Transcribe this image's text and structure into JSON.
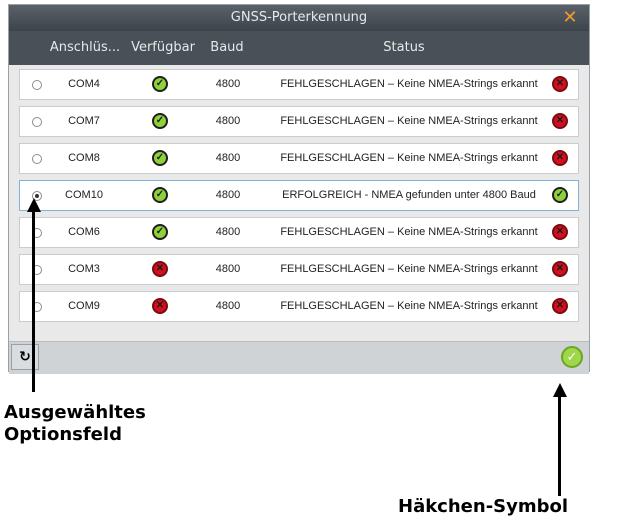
{
  "window": {
    "title": "GNSS-Porterkennung",
    "close_icon": "close-icon"
  },
  "columns": {
    "port": "Anschlüs...",
    "available": "Verfügbar",
    "baud": "Baud",
    "status": "Status"
  },
  "rows": [
    {
      "port": "COM4",
      "available": "ok",
      "baud": "4800",
      "status": "FEHLGESCHLAGEN – Keine NMEA-Strings erkannt",
      "result": "err",
      "selected": false
    },
    {
      "port": "COM7",
      "available": "ok",
      "baud": "4800",
      "status": "FEHLGESCHLAGEN – Keine NMEA-Strings erkannt",
      "result": "err",
      "selected": false
    },
    {
      "port": "COM8",
      "available": "ok",
      "baud": "4800",
      "status": "FEHLGESCHLAGEN – Keine NMEA-Strings erkannt",
      "result": "err",
      "selected": false
    },
    {
      "port": "COM10",
      "available": "ok",
      "baud": "4800",
      "status": "ERFOLGREICH - NMEA gefunden unter 4800 Baud",
      "result": "ok",
      "selected": true
    },
    {
      "port": "COM6",
      "available": "ok",
      "baud": "4800",
      "status": "FEHLGESCHLAGEN – Keine NMEA-Strings erkannt",
      "result": "err",
      "selected": false
    },
    {
      "port": "COM3",
      "available": "err",
      "baud": "4800",
      "status": "FEHLGESCHLAGEN – Keine NMEA-Strings erkannt",
      "result": "err",
      "selected": false
    },
    {
      "port": "COM9",
      "available": "err",
      "baud": "4800",
      "status": "FEHLGESCHLAGEN – Keine NMEA-Strings erkannt",
      "result": "err",
      "selected": false
    }
  ],
  "annotations": {
    "radio_label_line1": "Ausgewähltes",
    "radio_label_line2": "Optionsfeld",
    "check_label": "Häkchen-Symbol"
  },
  "colors": {
    "ok_green": "#8fd13a",
    "error_red": "#d0101e",
    "close_orange": "#f39a2d"
  }
}
